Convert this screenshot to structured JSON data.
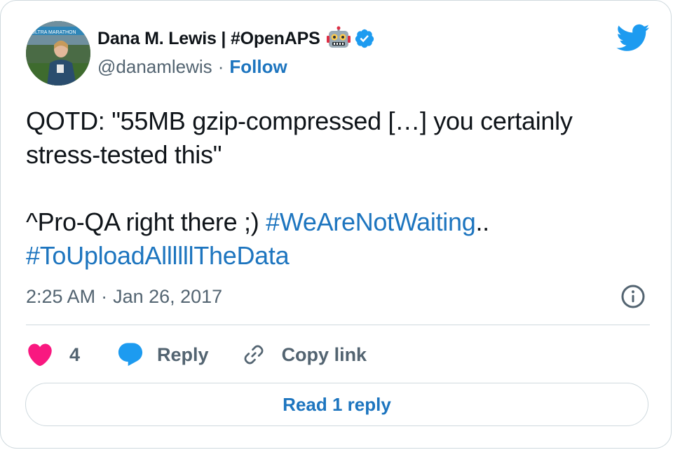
{
  "author": {
    "name": "Dana M. Lewis | #OpenAPS",
    "handle": "@danamlewis",
    "separator": "·",
    "follow_label": "Follow",
    "avatar_banner_text": "ULTRA MARATHON"
  },
  "tweet": {
    "line1": "QOTD: \"55MB gzip-compressed […] you certainly",
    "line2": "stress-tested this\"",
    "line3_prefix": "^Pro-QA right there ;) ",
    "hashtag1": "#WeAreNotWaiting",
    "line3_suffix": "..",
    "hashtag2": "#ToUploadAllllllTheData"
  },
  "meta": {
    "time": "2:25 AM",
    "separator": "·",
    "date": "Jan 26, 2017"
  },
  "actions": {
    "like_count": "4",
    "reply_label": "Reply",
    "copy_link_label": "Copy link"
  },
  "read_replies_label": "Read 1 reply",
  "colors": {
    "accent_blue": "#1d75bf",
    "twitter_blue": "#1d9bf0",
    "like_pink": "#f91880",
    "muted_text": "#536471",
    "border": "#cfd9de"
  },
  "icons": [
    "robot-emoji-icon",
    "verified-badge-icon",
    "twitter-bird-icon",
    "info-icon",
    "heart-icon",
    "reply-bubble-icon",
    "link-icon"
  ]
}
